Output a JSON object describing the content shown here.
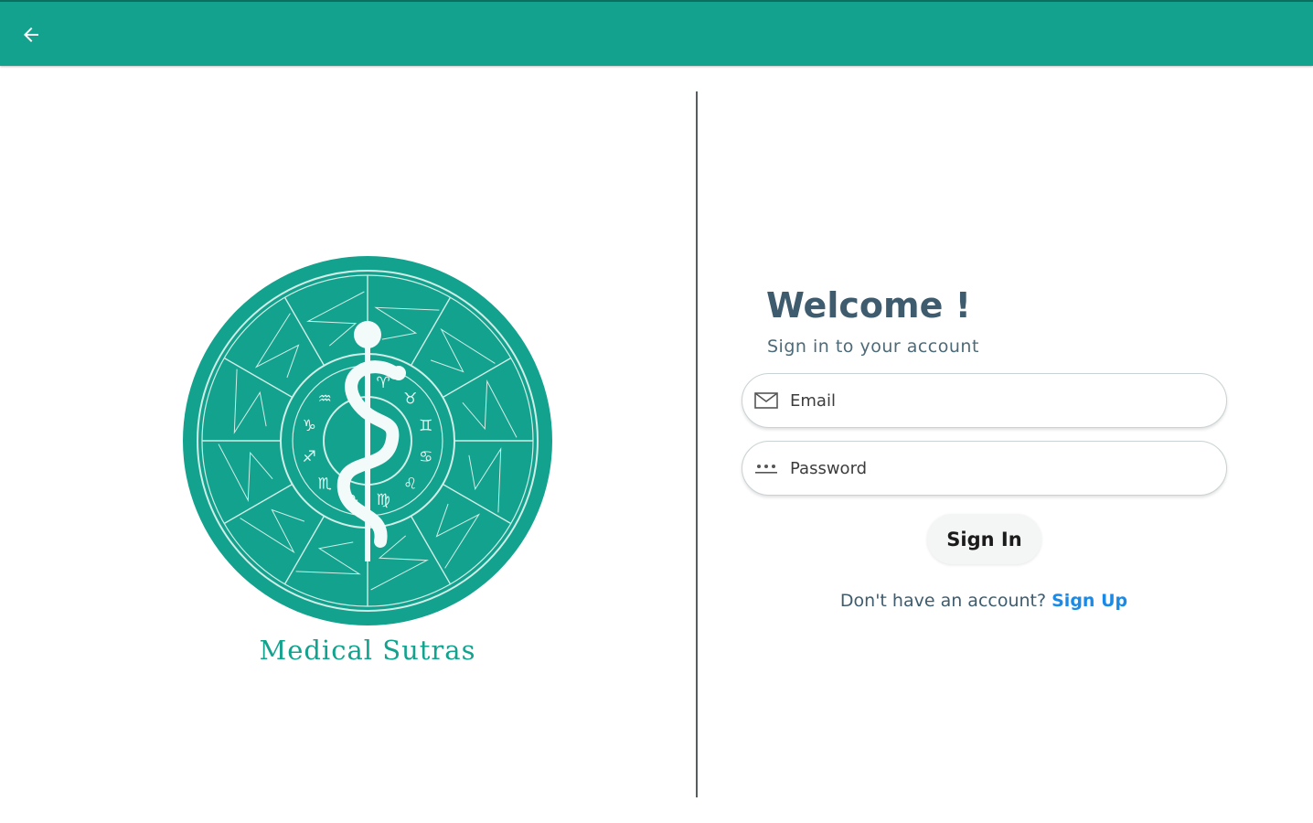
{
  "header": {
    "back_icon": "arrow-left-icon",
    "background_color": "#13a28e"
  },
  "brand": {
    "logo_icon": "caduceus-zodiac-wheel-logo",
    "name": "Medical Sutras",
    "color": "#13a28e"
  },
  "login": {
    "title": "Welcome !",
    "subtitle": "Sign in to your account",
    "email": {
      "icon": "envelope-icon",
      "placeholder": "Email",
      "value": ""
    },
    "password": {
      "icon": "password-dots-icon",
      "placeholder": "Password",
      "value": ""
    },
    "submit_label": "Sign In",
    "signup_prompt": "Don't have an account?",
    "signup_link": "Sign Up",
    "link_color": "#1a8ae6"
  }
}
